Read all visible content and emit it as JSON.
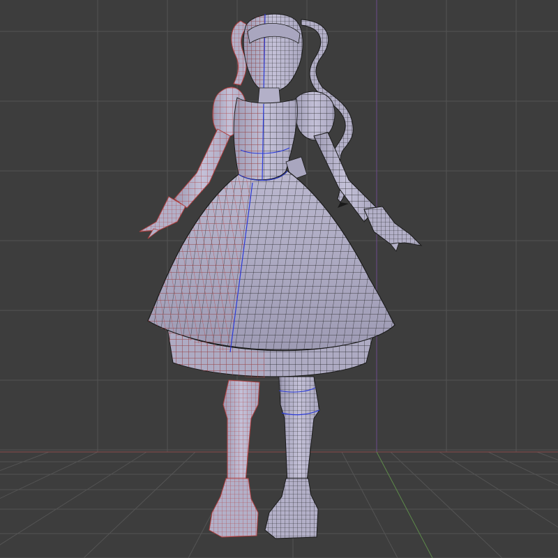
{
  "viewport": {
    "mode": "3d-viewport",
    "shading": "solid-with-wireframe",
    "background_color": "#3d3d3d",
    "grid_color": "#545454",
    "axis_x_color": "#8a4a4a",
    "axis_y_color": "#5d8a4a",
    "axis_z_color": "#6b4a8a"
  },
  "model": {
    "subject": "character-in-dress",
    "mesh_color": "#b3b0c8",
    "wire_color": "#1a1a1a",
    "mirror_wire_color": "#b04040",
    "seam_color": "#2a3ad8",
    "selected_half": "right",
    "parts": [
      "hair",
      "pigtails",
      "head",
      "bodice",
      "puff-sleeves",
      "arms",
      "hands",
      "skirt",
      "petticoat",
      "legs",
      "boots"
    ]
  }
}
